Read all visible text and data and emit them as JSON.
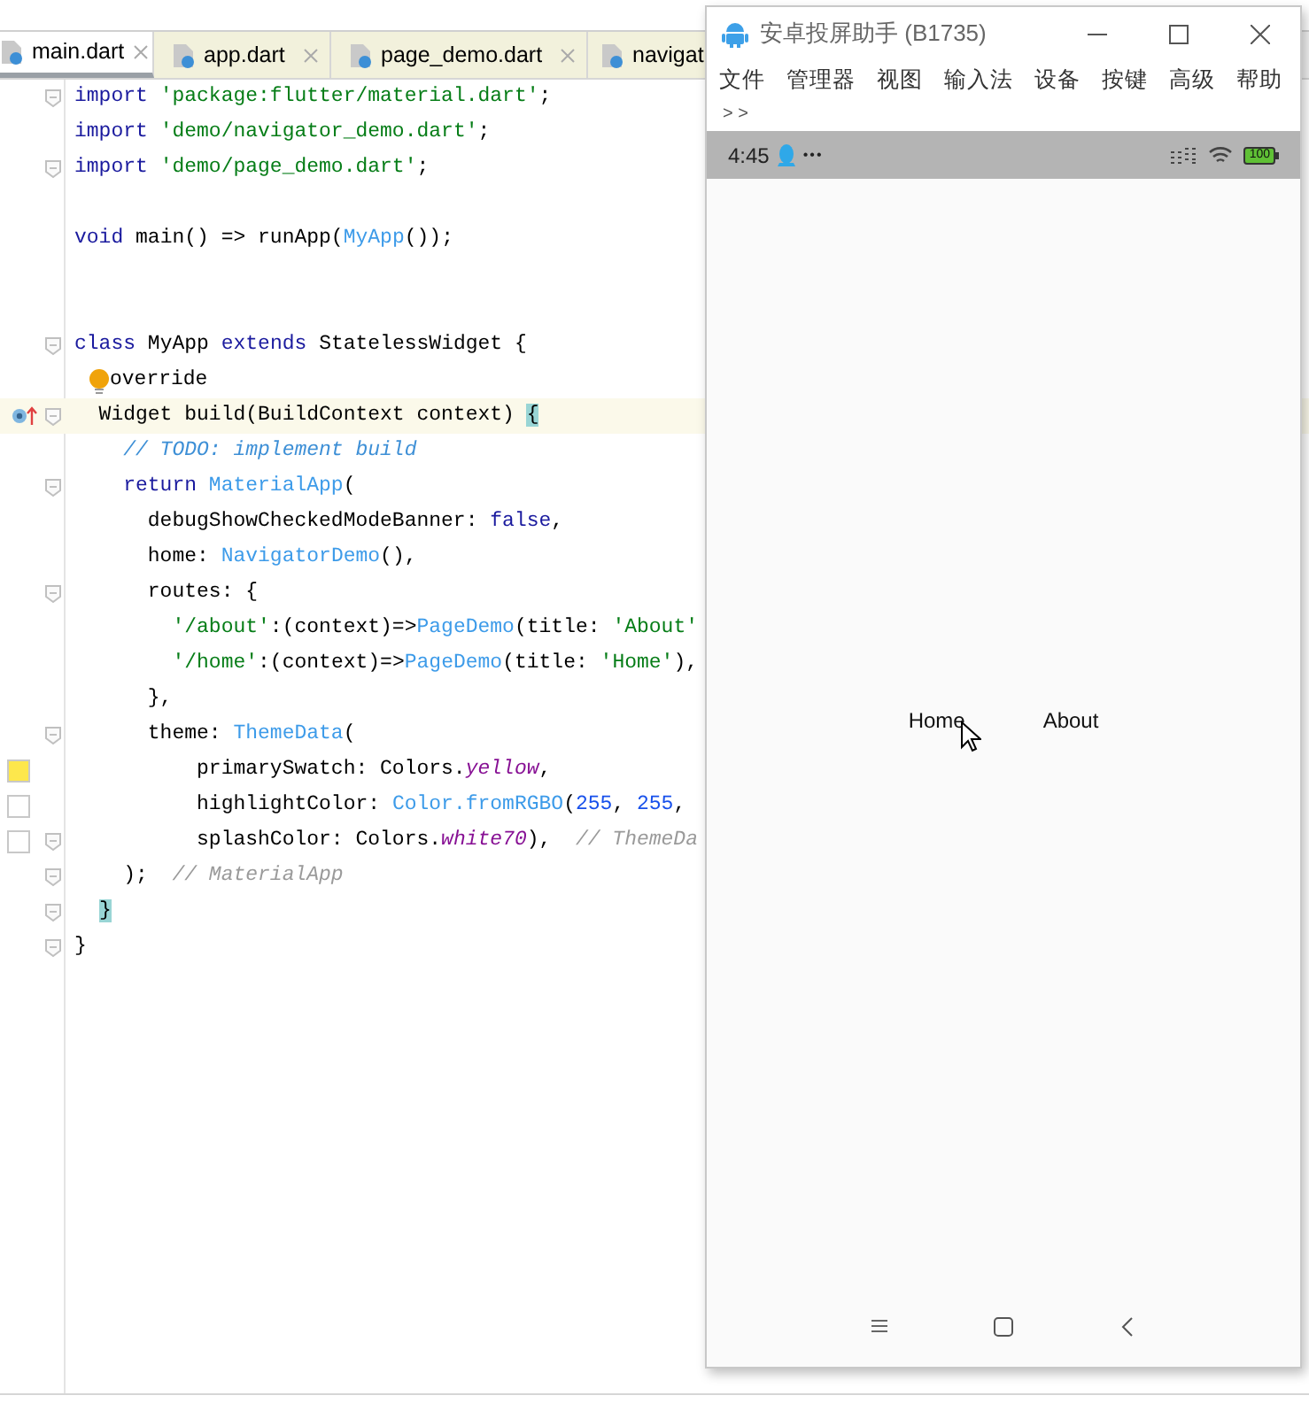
{
  "editor": {
    "tabs": [
      {
        "label": "main.dart",
        "selected": true,
        "closable": true
      },
      {
        "label": "app.dart",
        "selected": false,
        "closable": true
      },
      {
        "label": "page_demo.dart",
        "selected": false,
        "closable": true
      },
      {
        "label": "navigat",
        "selected": false,
        "closable": false
      }
    ],
    "lines": [
      {
        "kind": "code",
        "fold": true,
        "parts": [
          {
            "text": "import ",
            "kind": "keyword"
          },
          {
            "text": "'package:flutter/material.dart'",
            "kind": "string"
          },
          {
            "text": ";",
            "kind": "plain"
          }
        ]
      },
      {
        "kind": "code",
        "fold": false,
        "parts": [
          {
            "text": "import ",
            "kind": "keyword"
          },
          {
            "text": "'demo/navigator_demo.dart'",
            "kind": "string"
          },
          {
            "text": ";",
            "kind": "plain"
          }
        ]
      },
      {
        "kind": "code",
        "fold": true,
        "parts": [
          {
            "text": "import ",
            "kind": "keyword"
          },
          {
            "text": "'demo/page_demo.dart'",
            "kind": "string"
          },
          {
            "text": ";",
            "kind": "plain"
          }
        ]
      },
      {
        "kind": "blank"
      },
      {
        "kind": "code",
        "fold": false,
        "parts": [
          {
            "text": "void ",
            "kind": "keyword"
          },
          {
            "text": "main() => runApp(",
            "kind": "plain"
          },
          {
            "text": "MyApp",
            "kind": "type"
          },
          {
            "text": "());",
            "kind": "plain"
          }
        ]
      },
      {
        "kind": "blank"
      },
      {
        "kind": "blank"
      },
      {
        "kind": "code",
        "fold": true,
        "parts": [
          {
            "text": "class ",
            "kind": "keyword"
          },
          {
            "text": "MyApp ",
            "kind": "plain"
          },
          {
            "text": "extends ",
            "kind": "keyword"
          },
          {
            "text": "StatelessWidget {",
            "kind": "plain"
          }
        ]
      },
      {
        "kind": "code",
        "fold": false,
        "bulb": true,
        "parts": [
          {
            "text": "override",
            "kind": "plain"
          }
        ]
      },
      {
        "kind": "code",
        "fold": true,
        "current": true,
        "gutter": {
          "kind": "override"
        },
        "parts": [
          {
            "text": "  Widget build(BuildContext context) ",
            "kind": "plain"
          },
          {
            "text": "{",
            "kind": "match"
          }
        ]
      },
      {
        "kind": "code",
        "fold": false,
        "parts": [
          {
            "text": "    // TODO: implement build",
            "kind": "todo"
          }
        ]
      },
      {
        "kind": "code",
        "fold": true,
        "parts": [
          {
            "text": "    return ",
            "kind": "keyword"
          },
          {
            "text": "MaterialApp",
            "kind": "type"
          },
          {
            "text": "(",
            "kind": "plain"
          }
        ]
      },
      {
        "kind": "code",
        "fold": false,
        "parts": [
          {
            "text": "      debugShowCheckedModeBanner: ",
            "kind": "plain"
          },
          {
            "text": "false",
            "kind": "keyword"
          },
          {
            "text": ",",
            "kind": "plain"
          }
        ]
      },
      {
        "kind": "code",
        "fold": false,
        "parts": [
          {
            "text": "      home: ",
            "kind": "plain"
          },
          {
            "text": "NavigatorDemo",
            "kind": "type"
          },
          {
            "text": "(),",
            "kind": "plain"
          }
        ]
      },
      {
        "kind": "code",
        "fold": true,
        "parts": [
          {
            "text": "      routes: {",
            "kind": "plain"
          }
        ]
      },
      {
        "kind": "code",
        "fold": false,
        "parts": [
          {
            "text": "        '/about'",
            "kind": "string"
          },
          {
            "text": ":(context)=>",
            "kind": "plain"
          },
          {
            "text": "PageDemo",
            "kind": "type"
          },
          {
            "text": "(title: ",
            "kind": "plain"
          },
          {
            "text": "'About'",
            "kind": "string"
          }
        ]
      },
      {
        "kind": "code",
        "fold": false,
        "parts": [
          {
            "text": "        '/home'",
            "kind": "string"
          },
          {
            "text": ":(context)=>",
            "kind": "plain"
          },
          {
            "text": "PageDemo",
            "kind": "type"
          },
          {
            "text": "(title: ",
            "kind": "plain"
          },
          {
            "text": "'Home'",
            "kind": "string"
          },
          {
            "text": "),",
            "kind": "plain"
          }
        ]
      },
      {
        "kind": "code",
        "fold": false,
        "parts": [
          {
            "text": "      },",
            "kind": "plain"
          }
        ]
      },
      {
        "kind": "code",
        "fold": true,
        "parts": [
          {
            "text": "      theme: ",
            "kind": "plain"
          },
          {
            "text": "ThemeData",
            "kind": "type"
          },
          {
            "text": "(",
            "kind": "plain"
          }
        ]
      },
      {
        "kind": "code",
        "fold": false,
        "gutter": {
          "kind": "swatch",
          "color": "#fde74c"
        },
        "parts": [
          {
            "text": "          primarySwatch: Colors.",
            "kind": "plain"
          },
          {
            "text": "yellow",
            "kind": "constant"
          },
          {
            "text": ",",
            "kind": "plain"
          }
        ]
      },
      {
        "kind": "code",
        "fold": false,
        "gutter": {
          "kind": "swatch",
          "color": "#ffffff"
        },
        "parts": [
          {
            "text": "          highlightColor: ",
            "kind": "plain"
          },
          {
            "text": "Color.fromRGBO",
            "kind": "type"
          },
          {
            "text": "(",
            "kind": "plain"
          },
          {
            "text": "255",
            "kind": "number"
          },
          {
            "text": ", ",
            "kind": "plain"
          },
          {
            "text": "255",
            "kind": "number"
          },
          {
            "text": ",",
            "kind": "plain"
          }
        ]
      },
      {
        "kind": "code",
        "fold": true,
        "gutter": {
          "kind": "swatch",
          "color": "#ffffff"
        },
        "parts": [
          {
            "text": "          splashColor: Colors.",
            "kind": "plain"
          },
          {
            "text": "white70",
            "kind": "constant"
          },
          {
            "text": "),  ",
            "kind": "plain"
          },
          {
            "text": "// ThemeDa",
            "kind": "comment"
          }
        ]
      },
      {
        "kind": "code",
        "fold": true,
        "parts": [
          {
            "text": "    );  ",
            "kind": "plain"
          },
          {
            "text": "// MaterialApp",
            "kind": "comment"
          }
        ]
      },
      {
        "kind": "code",
        "fold": true,
        "parts": [
          {
            "text": "}",
            "kind": "match"
          }
        ]
      },
      {
        "kind": "code",
        "fold": true,
        "parts": [
          {
            "text": "}",
            "kind": "plain"
          }
        ]
      }
    ]
  },
  "mirror_window": {
    "title": "安卓投屏助手 (B1735)",
    "menu": [
      "文件",
      "管理器",
      "视图",
      "输入法",
      "设备",
      "按键",
      "高级",
      "帮助"
    ],
    "overflow": "> >",
    "status_bar": {
      "time": "4:45",
      "dots": "•••",
      "battery": "100"
    },
    "screen": {
      "links": [
        "Home",
        "About"
      ]
    }
  }
}
